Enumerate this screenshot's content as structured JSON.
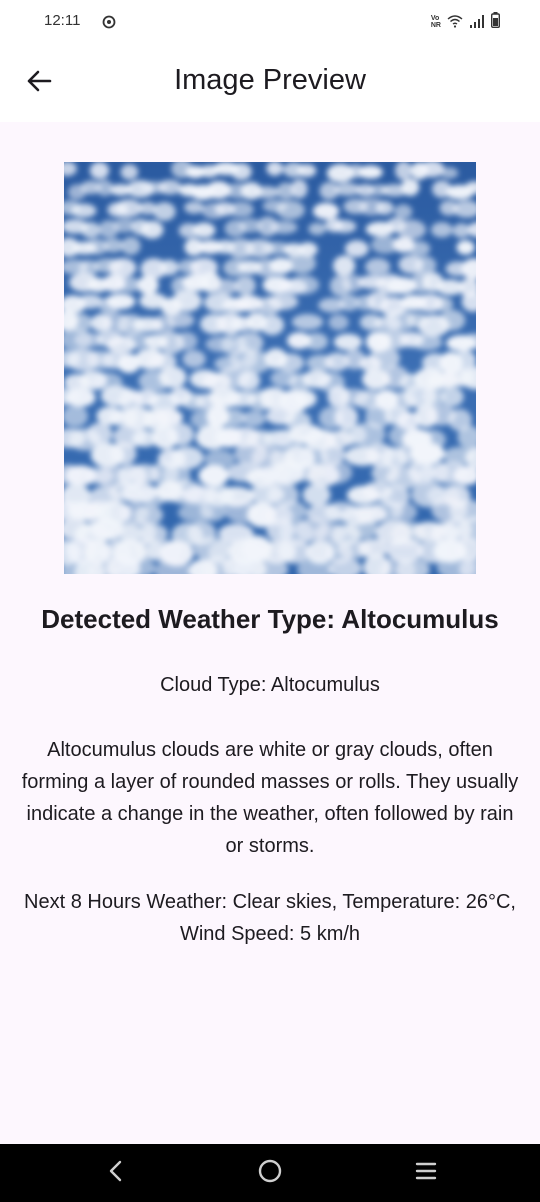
{
  "status_bar": {
    "time": "12:11",
    "icons": [
      "clock-icon",
      "vonr-icon",
      "wifi-icon",
      "signal-icon",
      "battery-icon"
    ],
    "vonr_line1": "Vo",
    "vonr_line2": "NR"
  },
  "app_bar": {
    "title": "Image Preview",
    "back_icon": "arrow-left-icon"
  },
  "preview": {
    "colors": {
      "sky": "#2f62a8",
      "cloud": "#f2f5fb"
    }
  },
  "result": {
    "detected": "Detected Weather Type: Altocumulus",
    "cloud_type": "Cloud Type: Altocumulus",
    "description": "Altocumulus clouds are white or gray clouds, often forming a layer of rounded masses or rolls. They usually indicate a change in the weather, often followed by rain or storms.",
    "forecast": "Next 8 Hours Weather: Clear skies, Temperature: 26°C, Wind Speed: 5 km/h"
  },
  "nav_bar": {
    "icons": [
      "back-nav-icon",
      "home-nav-icon",
      "recents-nav-icon"
    ]
  },
  "colors": {
    "background": "#fdf7fe",
    "app_bar": "#ffffff",
    "text": "#1d1b20",
    "nav_bar": "#000000"
  }
}
